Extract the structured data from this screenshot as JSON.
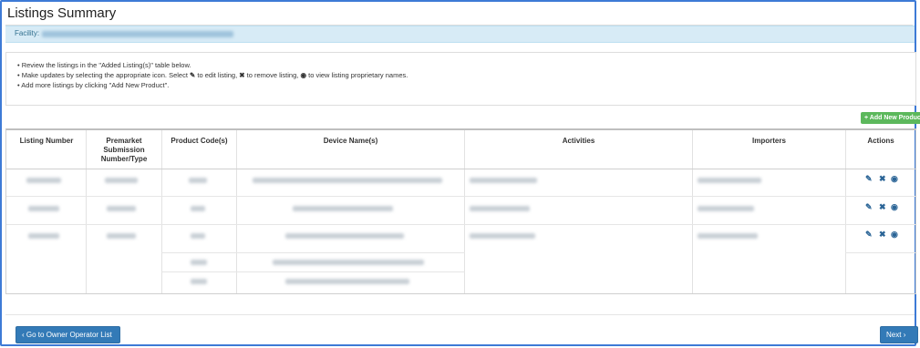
{
  "page": {
    "title": "Listings Summary"
  },
  "facility": {
    "label": "Facility:"
  },
  "instructions": {
    "line1": "Review the listings in the \"Added Listing(s)\" table below.",
    "line2_a": "Make updates by selecting the appropriate icon. Select",
    "line2_b": "to edit listing,",
    "line2_c": "to remove listing,",
    "line2_d": "to view listing proprietary names.",
    "line3": "Add more listings by clicking \"Add New Product\"."
  },
  "add_button": {
    "label": "+ Add New Product"
  },
  "table": {
    "headers": {
      "listing_number": "Listing Number",
      "premarket": "Premarket Submission Number/Type",
      "product_codes": "Product Code(s)",
      "device_names": "Device Name(s)",
      "activities": "Activities",
      "importers": "Importers",
      "actions": "Actions"
    }
  },
  "icons": {
    "edit": "pencil-icon",
    "remove": "x-icon",
    "view": "eye-icon"
  },
  "footer": {
    "back_label": "Go to Owner Operator List",
    "next_label": "Next"
  },
  "colors": {
    "primary": "#337ab7",
    "success": "#5cb85c",
    "info_bg": "#d7ebf6"
  }
}
